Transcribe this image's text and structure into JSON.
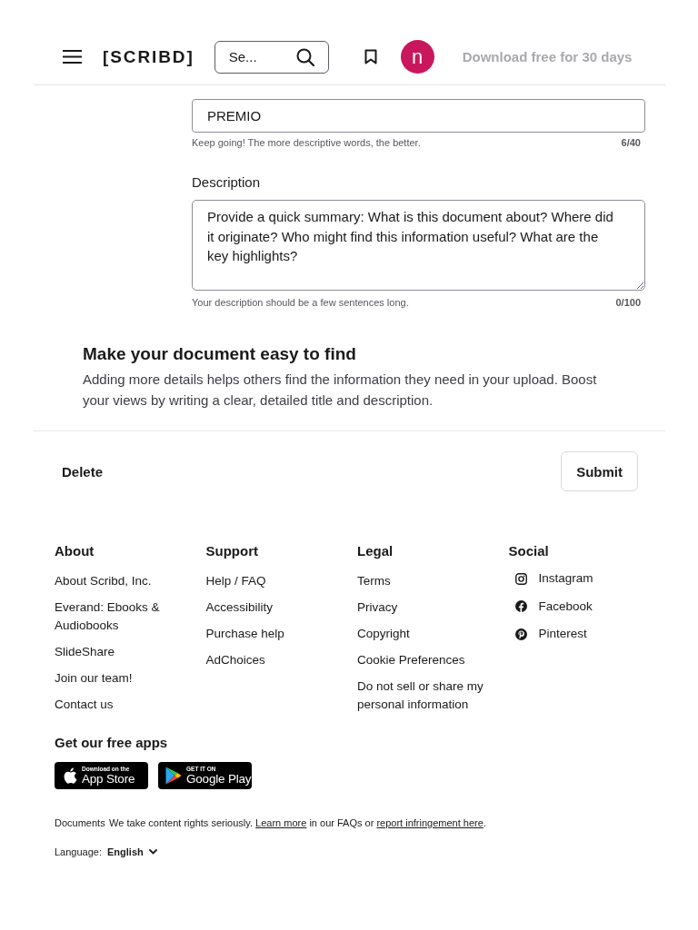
{
  "header": {
    "logo": "[SCRIBD]",
    "search": {
      "placeholder": "Se..."
    },
    "avatar": {
      "initial": "n"
    },
    "promo": "Download free for 30 days"
  },
  "title_field": {
    "value": "PREMIO",
    "hint": "Keep going! The more descriptive words, the better.",
    "count": "6/40"
  },
  "description_field": {
    "label": "Description",
    "placeholder": "Provide a quick summary: What is this document about? Where did it originate? Who might find this information useful? What are the key highlights?",
    "hint": "Your description should be a few sentences long.",
    "count": "0/100"
  },
  "tips": {
    "heading": "Make your document easy to find",
    "text": "Adding more details helps others find the information they need in your upload. Boost your views by writing a clear, detailed title and description."
  },
  "actions": {
    "delete": "Delete",
    "submit": "Submit"
  },
  "footer": {
    "columns": [
      {
        "kind": "links",
        "heading": "About",
        "links": [
          "About Scribd, Inc.",
          "Everand: Ebooks & Audiobooks",
          "SlideShare",
          "Join our team!",
          "Contact us"
        ]
      },
      {
        "kind": "links",
        "heading": "Support",
        "links": [
          "Help / FAQ",
          "Accessibility",
          "Purchase help",
          "AdChoices"
        ]
      },
      {
        "kind": "links",
        "heading": "Legal",
        "links": [
          "Terms",
          "Privacy",
          "Copyright",
          "Cookie Preferences",
          "Do not sell or share my personal information"
        ]
      },
      {
        "kind": "social",
        "heading": "Social",
        "links": [
          "Instagram",
          "Facebook",
          "Pinterest"
        ]
      }
    ],
    "apps": {
      "heading": "Get our free apps",
      "badges": [
        {
          "kind": "apple",
          "small": "Download on the",
          "large": "App Store"
        },
        {
          "kind": "google",
          "small": "GET IT ON",
          "large": "Google Play"
        }
      ]
    },
    "documents": "Documents",
    "rights_notice": [
      {
        "kind": "text",
        "text": "We take content rights seriously. "
      },
      {
        "kind": "link",
        "text": "Learn more"
      },
      {
        "kind": "text",
        "text": " in our FAQs or "
      },
      {
        "kind": "link",
        "text": "report infringement here"
      },
      {
        "kind": "text",
        "text": "."
      }
    ],
    "language": {
      "label": "Language:",
      "value": "English"
    }
  }
}
